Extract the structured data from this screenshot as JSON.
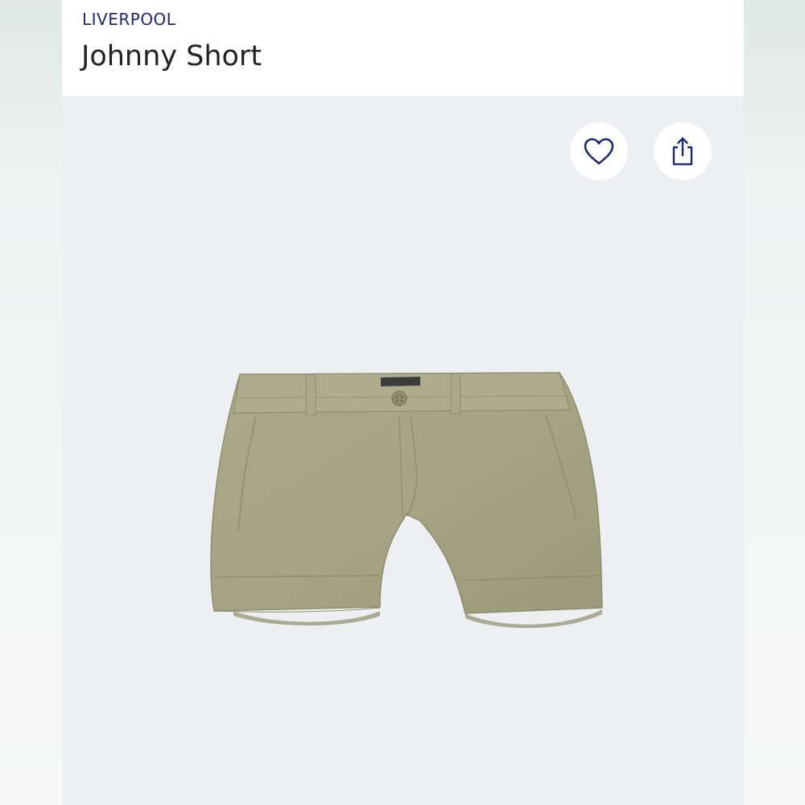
{
  "header": {
    "brand": "LIVERPOOL",
    "title": "Johnny Short"
  },
  "actions": {
    "favorite_icon": "heart-outline-icon",
    "share_icon": "share-upload-icon"
  },
  "product": {
    "image_subject": "olive chino shorts",
    "garment_color": "#a7a585",
    "background_color": "#eeeff3"
  },
  "colors": {
    "brand": "#1f2a6d",
    "title_text": "#232323"
  }
}
